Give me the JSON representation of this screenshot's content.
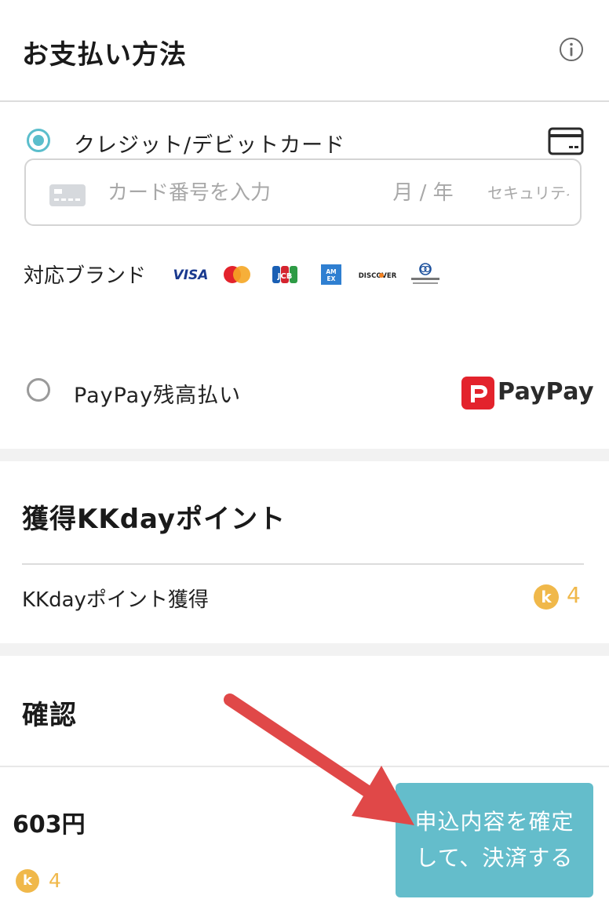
{
  "payment": {
    "title": "お支払い方法",
    "info_icon": "info-icon",
    "credit_option": {
      "label": "クレジット/デビットカード",
      "selected": true,
      "icon": "credit-card-icon"
    },
    "card_input": {
      "number_placeholder": "カード番号を入力",
      "expiry_placeholder": "月 / 年",
      "security_placeholder": "セキュリティコ"
    },
    "brands": {
      "label": "対応ブランド",
      "logos": [
        "visa-logo",
        "mastercard-logo",
        "jcb-logo",
        "amex-logo",
        "discover-logo",
        "diners-club-logo"
      ]
    },
    "paypay_option": {
      "label": "PayPay残高払い",
      "selected": false,
      "logo_text": "PayPay"
    }
  },
  "points": {
    "title": "獲得KKdayポイント",
    "label": "KKdayポイント獲得",
    "coin_letter": "k",
    "value": "4"
  },
  "confirm": {
    "title": "確認"
  },
  "bottom_bar": {
    "total": "603円",
    "coin_letter": "k",
    "points": "4",
    "submit_label": "申込内容を確定して、決済する"
  },
  "colors": {
    "accent": "#64bdcb",
    "radio": "#5bbecc",
    "coin": "#f0b84a",
    "paypay_red": "#e3232c",
    "arrow": "#e04848"
  }
}
